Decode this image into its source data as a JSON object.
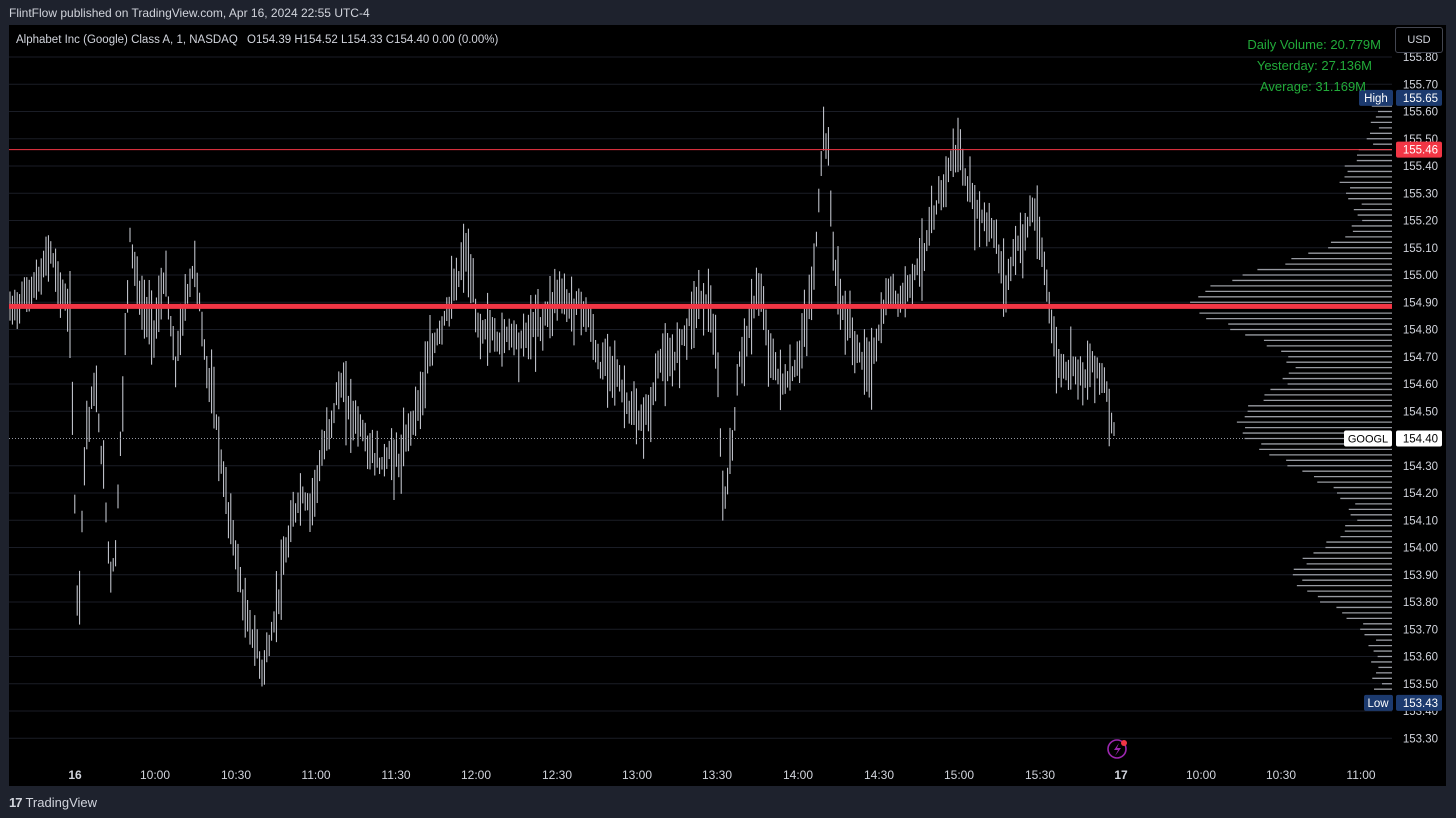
{
  "header": {
    "published_text": "FlintFlow published on TradingView.com, Apr 16, 2024 22:55 UTC-4"
  },
  "legend": {
    "symbol_name": "Alphabet Inc (Google) Class A, 1, NASDAQ",
    "ohlc": "O154.39  H154.52  L154.33  C154.40  0.00 (0.00%)"
  },
  "volume_info": {
    "daily": "Daily Volume: 20.779M",
    "yesterday": "Yesterday: 27.136M",
    "average": "Average: 31.169M"
  },
  "currency_button": "USD",
  "footer": {
    "brand": "TradingView"
  },
  "colors": {
    "background": "#000000",
    "frame": "#1e222d",
    "bars": "#d1d4dc",
    "red_line": "#f23645",
    "green_text": "#22ab3a",
    "high_low_badge": "#1c3a6e"
  },
  "chart_data": {
    "type": "ohlc",
    "symbol": "GOOGL",
    "interval": "1",
    "y_ticks": [
      "155.80",
      "155.70",
      "155.60",
      "155.50",
      "155.40",
      "155.30",
      "155.20",
      "155.10",
      "155.00",
      "154.90",
      "154.80",
      "154.70",
      "154.60",
      "154.50",
      "154.30",
      "154.20",
      "154.10",
      "154.00",
      "153.90",
      "153.80",
      "153.70",
      "153.60",
      "153.50",
      "153.40",
      "153.30"
    ],
    "x_ticks": [
      "16",
      "10:00",
      "10:30",
      "11:00",
      "11:30",
      "12:00",
      "12:30",
      "13:00",
      "13:30",
      "14:00",
      "14:30",
      "15:00",
      "15:30",
      "17",
      "10:00",
      "10:30",
      "11:00"
    ],
    "ylim": [
      153.25,
      155.85
    ],
    "last_price": 154.4,
    "last_price_label": "GOOGL",
    "high": {
      "label": "High",
      "value": 155.65
    },
    "low": {
      "label": "Low",
      "value": 153.43
    },
    "red_levels": [
      155.46,
      154.885
    ],
    "price_path": [
      [
        9,
        154.86
      ],
      [
        40,
        154.98
      ],
      [
        50,
        155.1
      ],
      [
        60,
        154.95
      ],
      [
        70,
        154.85
      ],
      [
        78,
        153.7
      ],
      [
        85,
        154.4
      ],
      [
        95,
        154.6
      ],
      [
        105,
        154.2
      ],
      [
        110,
        153.9
      ],
      [
        115,
        153.95
      ],
      [
        122,
        154.5
      ],
      [
        130,
        155.15
      ],
      [
        140,
        154.9
      ],
      [
        155,
        154.8
      ],
      [
        165,
        155.0
      ],
      [
        175,
        154.65
      ],
      [
        185,
        154.9
      ],
      [
        195,
        155.05
      ],
      [
        205,
        154.7
      ],
      [
        215,
        154.5
      ],
      [
        225,
        154.2
      ],
      [
        235,
        154.0
      ],
      [
        245,
        153.75
      ],
      [
        255,
        153.65
      ],
      [
        262,
        153.55
      ],
      [
        270,
        153.65
      ],
      [
        280,
        153.85
      ],
      [
        290,
        154.05
      ],
      [
        300,
        154.2
      ],
      [
        310,
        154.15
      ],
      [
        320,
        154.3
      ],
      [
        330,
        154.45
      ],
      [
        340,
        154.6
      ],
      [
        350,
        154.5
      ],
      [
        360,
        154.45
      ],
      [
        370,
        154.35
      ],
      [
        380,
        154.3
      ],
      [
        390,
        154.35
      ],
      [
        400,
        154.3
      ],
      [
        410,
        154.45
      ],
      [
        420,
        154.55
      ],
      [
        430,
        154.7
      ],
      [
        440,
        154.8
      ],
      [
        450,
        154.9
      ],
      [
        460,
        155.0
      ],
      [
        465,
        155.1
      ],
      [
        470,
        155.0
      ],
      [
        478,
        154.8
      ],
      [
        490,
        154.8
      ],
      [
        500,
        154.75
      ],
      [
        510,
        154.8
      ],
      [
        520,
        154.75
      ],
      [
        530,
        154.8
      ],
      [
        540,
        154.82
      ],
      [
        550,
        154.88
      ],
      [
        558,
        154.95
      ],
      [
        570,
        154.88
      ],
      [
        580,
        154.9
      ],
      [
        590,
        154.82
      ],
      [
        600,
        154.65
      ],
      [
        610,
        154.7
      ],
      [
        620,
        154.6
      ],
      [
        630,
        154.5
      ],
      [
        640,
        154.45
      ],
      [
        650,
        154.5
      ],
      [
        660,
        154.7
      ],
      [
        670,
        154.65
      ],
      [
        680,
        154.75
      ],
      [
        690,
        154.85
      ],
      [
        700,
        154.92
      ],
      [
        710,
        154.9
      ],
      [
        718,
        154.6
      ],
      [
        723,
        154.15
      ],
      [
        730,
        154.3
      ],
      [
        740,
        154.7
      ],
      [
        750,
        154.8
      ],
      [
        758,
        154.98
      ],
      [
        765,
        154.8
      ],
      [
        775,
        154.65
      ],
      [
        785,
        154.6
      ],
      [
        795,
        154.65
      ],
      [
        805,
        154.8
      ],
      [
        812,
        154.95
      ],
      [
        818,
        155.2
      ],
      [
        823,
        155.55
      ],
      [
        828,
        155.45
      ],
      [
        833,
        155.1
      ],
      [
        840,
        154.9
      ],
      [
        850,
        154.8
      ],
      [
        860,
        154.7
      ],
      [
        870,
        154.65
      ],
      [
        880,
        154.8
      ],
      [
        890,
        154.95
      ],
      [
        900,
        154.9
      ],
      [
        910,
        154.98
      ],
      [
        920,
        155.05
      ],
      [
        930,
        155.15
      ],
      [
        940,
        155.3
      ],
      [
        950,
        155.4
      ],
      [
        958,
        155.48
      ],
      [
        965,
        155.35
      ],
      [
        975,
        155.25
      ],
      [
        985,
        155.2
      ],
      [
        995,
        155.15
      ],
      [
        1005,
        154.95
      ],
      [
        1015,
        155.1
      ],
      [
        1025,
        155.15
      ],
      [
        1033,
        155.25
      ],
      [
        1040,
        155.1
      ],
      [
        1048,
        154.95
      ],
      [
        1055,
        154.7
      ],
      [
        1065,
        154.65
      ],
      [
        1075,
        154.68
      ],
      [
        1085,
        154.62
      ],
      [
        1095,
        154.68
      ],
      [
        1105,
        154.6
      ],
      [
        1110,
        154.5
      ],
      [
        1116,
        154.4
      ]
    ]
  }
}
